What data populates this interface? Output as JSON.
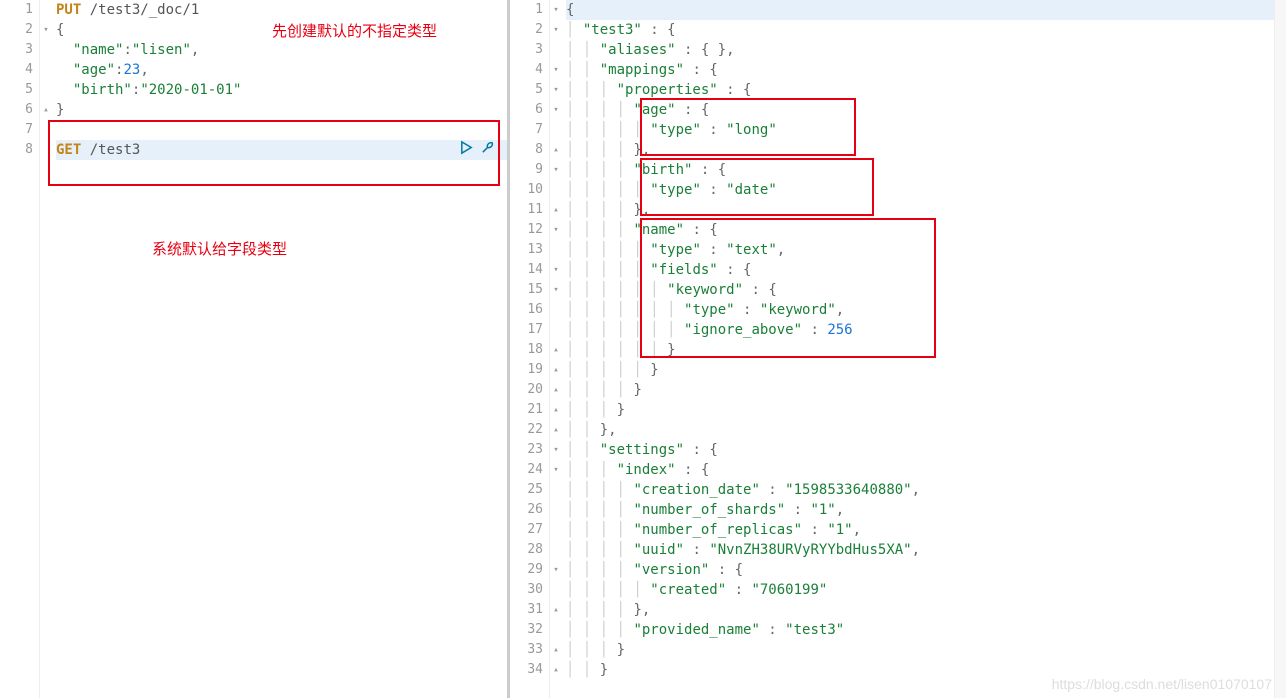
{
  "left": {
    "lines": [
      {
        "n": 1,
        "fold": "",
        "tokens": [
          {
            "t": "PUT",
            "c": "method"
          },
          {
            "t": " ",
            "c": ""
          },
          {
            "t": "/test3/_doc/1",
            "c": "path"
          }
        ]
      },
      {
        "n": 2,
        "fold": "▾",
        "tokens": [
          {
            "t": "{",
            "c": "punct"
          }
        ]
      },
      {
        "n": 3,
        "fold": "",
        "tokens": [
          {
            "t": "  ",
            "c": ""
          },
          {
            "t": "\"name\"",
            "c": "key"
          },
          {
            "t": ":",
            "c": "punct"
          },
          {
            "t": "\"lisen\"",
            "c": "str"
          },
          {
            "t": ",",
            "c": "punct"
          }
        ]
      },
      {
        "n": 4,
        "fold": "",
        "tokens": [
          {
            "t": "  ",
            "c": ""
          },
          {
            "t": "\"age\"",
            "c": "key"
          },
          {
            "t": ":",
            "c": "punct"
          },
          {
            "t": "23",
            "c": "num"
          },
          {
            "t": ",",
            "c": "punct"
          }
        ]
      },
      {
        "n": 5,
        "fold": "",
        "tokens": [
          {
            "t": "  ",
            "c": ""
          },
          {
            "t": "\"birth\"",
            "c": "key"
          },
          {
            "t": ":",
            "c": "punct"
          },
          {
            "t": "\"2020-01-01\"",
            "c": "str"
          }
        ]
      },
      {
        "n": 6,
        "fold": "▴",
        "tokens": [
          {
            "t": "}",
            "c": "punct"
          }
        ]
      },
      {
        "n": 7,
        "fold": "",
        "tokens": []
      },
      {
        "n": 8,
        "fold": "",
        "active": true,
        "tokens": [
          {
            "t": "GET",
            "c": "method"
          },
          {
            "t": " ",
            "c": ""
          },
          {
            "t": "/test3",
            "c": "path"
          }
        ],
        "runicons": true
      }
    ],
    "annotation1": "先创建默认的不指定类型",
    "annotation2": "系统默认给字段类型"
  },
  "right": {
    "lines": [
      {
        "n": 1,
        "fold": "▾",
        "active": true,
        "i": 0,
        "tokens": [
          {
            "t": "{",
            "c": "punct"
          }
        ]
      },
      {
        "n": 2,
        "fold": "▾",
        "i": 1,
        "tokens": [
          {
            "t": "\"test3\"",
            "c": "key"
          },
          {
            "t": " : ",
            "c": "punct"
          },
          {
            "t": "{",
            "c": "punct"
          }
        ]
      },
      {
        "n": 3,
        "fold": "",
        "i": 2,
        "tokens": [
          {
            "t": "\"aliases\"",
            "c": "key"
          },
          {
            "t": " : ",
            "c": "punct"
          },
          {
            "t": "{ }",
            "c": "punct"
          },
          {
            "t": ",",
            "c": "punct"
          }
        ]
      },
      {
        "n": 4,
        "fold": "▾",
        "i": 2,
        "tokens": [
          {
            "t": "\"mappings\"",
            "c": "key"
          },
          {
            "t": " : ",
            "c": "punct"
          },
          {
            "t": "{",
            "c": "punct"
          }
        ]
      },
      {
        "n": 5,
        "fold": "▾",
        "i": 3,
        "tokens": [
          {
            "t": "\"properties\"",
            "c": "key"
          },
          {
            "t": " : ",
            "c": "punct"
          },
          {
            "t": "{",
            "c": "punct"
          }
        ]
      },
      {
        "n": 6,
        "fold": "▾",
        "i": 4,
        "tokens": [
          {
            "t": "\"age\"",
            "c": "key"
          },
          {
            "t": " : ",
            "c": "punct"
          },
          {
            "t": "{",
            "c": "punct"
          }
        ]
      },
      {
        "n": 7,
        "fold": "",
        "i": 5,
        "tokens": [
          {
            "t": "\"type\"",
            "c": "key"
          },
          {
            "t": " : ",
            "c": "punct"
          },
          {
            "t": "\"long\"",
            "c": "str"
          }
        ]
      },
      {
        "n": 8,
        "fold": "▴",
        "i": 4,
        "tokens": [
          {
            "t": "}",
            "c": "punct"
          },
          {
            "t": ",",
            "c": "punct"
          }
        ]
      },
      {
        "n": 9,
        "fold": "▾",
        "i": 4,
        "tokens": [
          {
            "t": "\"birth\"",
            "c": "key"
          },
          {
            "t": " : ",
            "c": "punct"
          },
          {
            "t": "{",
            "c": "punct"
          }
        ]
      },
      {
        "n": 10,
        "fold": "",
        "i": 5,
        "tokens": [
          {
            "t": "\"type\"",
            "c": "key"
          },
          {
            "t": " : ",
            "c": "punct"
          },
          {
            "t": "\"date\"",
            "c": "str"
          }
        ]
      },
      {
        "n": 11,
        "fold": "▴",
        "i": 4,
        "tokens": [
          {
            "t": "}",
            "c": "punct"
          },
          {
            "t": ",",
            "c": "punct"
          }
        ]
      },
      {
        "n": 12,
        "fold": "▾",
        "i": 4,
        "tokens": [
          {
            "t": "\"name\"",
            "c": "key"
          },
          {
            "t": " : ",
            "c": "punct"
          },
          {
            "t": "{",
            "c": "punct"
          }
        ]
      },
      {
        "n": 13,
        "fold": "",
        "i": 5,
        "tokens": [
          {
            "t": "\"type\"",
            "c": "key"
          },
          {
            "t": " : ",
            "c": "punct"
          },
          {
            "t": "\"text\"",
            "c": "str"
          },
          {
            "t": ",",
            "c": "punct"
          }
        ]
      },
      {
        "n": 14,
        "fold": "▾",
        "i": 5,
        "tokens": [
          {
            "t": "\"fields\"",
            "c": "key"
          },
          {
            "t": " : ",
            "c": "punct"
          },
          {
            "t": "{",
            "c": "punct"
          }
        ]
      },
      {
        "n": 15,
        "fold": "▾",
        "i": 6,
        "tokens": [
          {
            "t": "\"keyword\"",
            "c": "key"
          },
          {
            "t": " : ",
            "c": "punct"
          },
          {
            "t": "{",
            "c": "punct"
          }
        ]
      },
      {
        "n": 16,
        "fold": "",
        "i": 7,
        "tokens": [
          {
            "t": "\"type\"",
            "c": "key"
          },
          {
            "t": " : ",
            "c": "punct"
          },
          {
            "t": "\"keyword\"",
            "c": "str"
          },
          {
            "t": ",",
            "c": "punct"
          }
        ]
      },
      {
        "n": 17,
        "fold": "",
        "i": 7,
        "tokens": [
          {
            "t": "\"ignore_above\"",
            "c": "key"
          },
          {
            "t": " : ",
            "c": "punct"
          },
          {
            "t": "256",
            "c": "num"
          }
        ]
      },
      {
        "n": 18,
        "fold": "▴",
        "i": 6,
        "tokens": [
          {
            "t": "}",
            "c": "punct"
          }
        ]
      },
      {
        "n": 19,
        "fold": "▴",
        "i": 5,
        "tokens": [
          {
            "t": "}",
            "c": "punct"
          }
        ]
      },
      {
        "n": 20,
        "fold": "▴",
        "i": 4,
        "tokens": [
          {
            "t": "}",
            "c": "punct"
          }
        ]
      },
      {
        "n": 21,
        "fold": "▴",
        "i": 3,
        "tokens": [
          {
            "t": "}",
            "c": "punct"
          }
        ]
      },
      {
        "n": 22,
        "fold": "▴",
        "i": 2,
        "tokens": [
          {
            "t": "}",
            "c": "punct"
          },
          {
            "t": ",",
            "c": "punct"
          }
        ]
      },
      {
        "n": 23,
        "fold": "▾",
        "i": 2,
        "tokens": [
          {
            "t": "\"settings\"",
            "c": "key"
          },
          {
            "t": " : ",
            "c": "punct"
          },
          {
            "t": "{",
            "c": "punct"
          }
        ]
      },
      {
        "n": 24,
        "fold": "▾",
        "i": 3,
        "tokens": [
          {
            "t": "\"index\"",
            "c": "key"
          },
          {
            "t": " : ",
            "c": "punct"
          },
          {
            "t": "{",
            "c": "punct"
          }
        ]
      },
      {
        "n": 25,
        "fold": "",
        "i": 4,
        "tokens": [
          {
            "t": "\"creation_date\"",
            "c": "key"
          },
          {
            "t": " : ",
            "c": "punct"
          },
          {
            "t": "\"1598533640880\"",
            "c": "str"
          },
          {
            "t": ",",
            "c": "punct"
          }
        ]
      },
      {
        "n": 26,
        "fold": "",
        "i": 4,
        "tokens": [
          {
            "t": "\"number_of_shards\"",
            "c": "key"
          },
          {
            "t": " : ",
            "c": "punct"
          },
          {
            "t": "\"1\"",
            "c": "str"
          },
          {
            "t": ",",
            "c": "punct"
          }
        ]
      },
      {
        "n": 27,
        "fold": "",
        "i": 4,
        "tokens": [
          {
            "t": "\"number_of_replicas\"",
            "c": "key"
          },
          {
            "t": " : ",
            "c": "punct"
          },
          {
            "t": "\"1\"",
            "c": "str"
          },
          {
            "t": ",",
            "c": "punct"
          }
        ]
      },
      {
        "n": 28,
        "fold": "",
        "i": 4,
        "tokens": [
          {
            "t": "\"uuid\"",
            "c": "key"
          },
          {
            "t": " : ",
            "c": "punct"
          },
          {
            "t": "\"NvnZH38URVyRYYbdHus5XA\"",
            "c": "str"
          },
          {
            "t": ",",
            "c": "punct"
          }
        ]
      },
      {
        "n": 29,
        "fold": "▾",
        "i": 4,
        "tokens": [
          {
            "t": "\"version\"",
            "c": "key"
          },
          {
            "t": " : ",
            "c": "punct"
          },
          {
            "t": "{",
            "c": "punct"
          }
        ]
      },
      {
        "n": 30,
        "fold": "",
        "i": 5,
        "tokens": [
          {
            "t": "\"created\"",
            "c": "key"
          },
          {
            "t": " : ",
            "c": "punct"
          },
          {
            "t": "\"7060199\"",
            "c": "str"
          }
        ]
      },
      {
        "n": 31,
        "fold": "▴",
        "i": 4,
        "tokens": [
          {
            "t": "}",
            "c": "punct"
          },
          {
            "t": ",",
            "c": "punct"
          }
        ]
      },
      {
        "n": 32,
        "fold": "",
        "i": 4,
        "tokens": [
          {
            "t": "\"provided_name\"",
            "c": "key"
          },
          {
            "t": " : ",
            "c": "punct"
          },
          {
            "t": "\"test3\"",
            "c": "str"
          }
        ]
      },
      {
        "n": 33,
        "fold": "▴",
        "i": 3,
        "tokens": [
          {
            "t": "}",
            "c": "punct"
          }
        ]
      },
      {
        "n": 34,
        "fold": "▴",
        "i": 2,
        "tokens": [
          {
            "t": "}",
            "c": "punct"
          }
        ]
      }
    ]
  },
  "watermark": "https://blog.csdn.net/lisen01070107"
}
